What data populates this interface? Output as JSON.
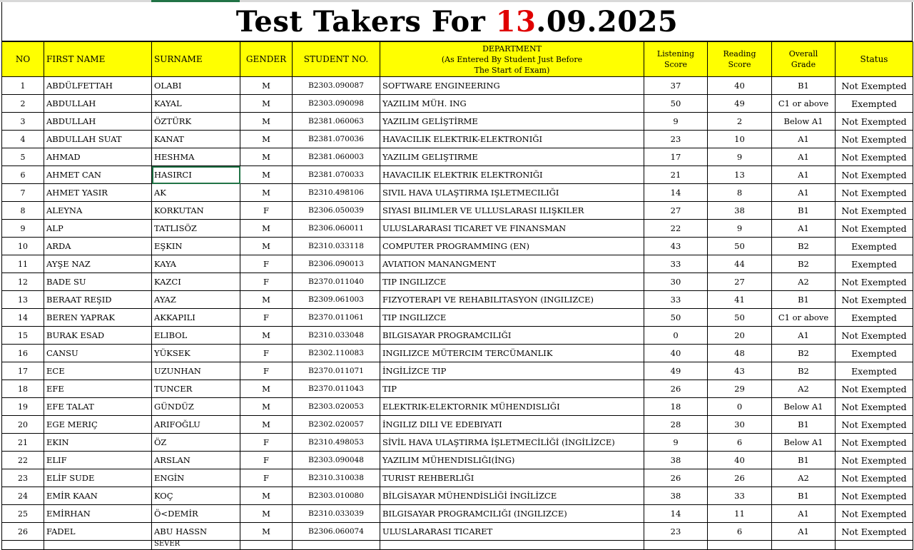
{
  "sheet": {
    "title_prefix": "Test Takers For ",
    "title_red": "13",
    "title_suffix": ".09.2025"
  },
  "header": {
    "no": "NO",
    "first_name": "FIRST NAME",
    "surname": "SURNAME",
    "gender": "GENDER",
    "student_no": "STUDENT NO.",
    "department_line1": "DEPARTMENT",
    "department_line2": "(As Entered By Student Just Before",
    "department_line3": "The Start of Exam)",
    "listening_line1": "Listening",
    "listening_line2": "Score",
    "reading_line1": "Reading",
    "reading_line2": "Score",
    "overall_line1": "Overall",
    "overall_line2": "Grade",
    "status": "Status"
  },
  "rows": [
    {
      "no": "1",
      "first": "ABDÜLFETTAH",
      "surname": "OLABI",
      "gender": "M",
      "student_no": "B2303.090087",
      "department": "SOFTWARE ENGINEERING",
      "listening": "37",
      "reading": "40",
      "grade": "B1",
      "status": "Not Exempted"
    },
    {
      "no": "2",
      "first": "ABDULLAH",
      "surname": "KAYAL",
      "gender": "M",
      "student_no": "B2303.090098",
      "department": "YAZILIM MÜH. ING",
      "listening": "50",
      "reading": "49",
      "grade": "C1 or above",
      "status": "Exempted"
    },
    {
      "no": "3",
      "first": "ABDULLAH",
      "surname": "ÖZTÜRK",
      "gender": "M",
      "student_no": "B2381.060063",
      "department": "YAZILIM GELİŞTİRME",
      "listening": "9",
      "reading": "2",
      "grade": "Below A1",
      "status": "Not Exempted"
    },
    {
      "no": "4",
      "first": "ABDULLAH SUAT",
      "surname": "KANAT",
      "gender": "M",
      "student_no": "B2381.070036",
      "department": "HAVACILIK ELEKTRIK-ELEKTRONIĞI",
      "listening": "23",
      "reading": "10",
      "grade": "A1",
      "status": "Not Exempted"
    },
    {
      "no": "5",
      "first": "AHMAD",
      "surname": "HESHMA",
      "gender": "M",
      "student_no": "B2381.060003",
      "department": "YAZILIM GELIŞTIRME",
      "listening": "17",
      "reading": "9",
      "grade": "A1",
      "status": "Not Exempted"
    },
    {
      "no": "6",
      "first": "AHMET CAN",
      "surname": "HASIRCI",
      "gender": "M",
      "student_no": "B2381.070033",
      "department": "HAVACILIK ELEKTRIK ELEKTRONIĞI",
      "listening": "21",
      "reading": "13",
      "grade": "A1",
      "status": "Not Exempted"
    },
    {
      "no": "7",
      "first": "AHMET YASIR",
      "surname": "AK",
      "gender": "M",
      "student_no": "B2310.498106",
      "department": "SIVIL HAVA ULAŞTIRMA IŞLETMECILIĞI",
      "listening": "14",
      "reading": "8",
      "grade": "A1",
      "status": "Not Exempted"
    },
    {
      "no": "8",
      "first": "ALEYNA",
      "surname": "KORKUTAN",
      "gender": "F",
      "student_no": "B2306.050039",
      "department": "SIYASI BILIMLER VE ULLUSLARASI ILIŞKILER",
      "listening": "27",
      "reading": "38",
      "grade": "B1",
      "status": "Not Exempted"
    },
    {
      "no": "9",
      "first": "ALP",
      "surname": "TATLISÖZ",
      "gender": "M",
      "student_no": "B2306.060011",
      "department": "ULUSLARARASI TICARET VE FINANSMAN",
      "listening": "22",
      "reading": "9",
      "grade": "A1",
      "status": "Not Exempted"
    },
    {
      "no": "10",
      "first": "ARDA",
      "surname": "EŞKIN",
      "gender": "M",
      "student_no": "B2310.033118",
      "department": "COMPUTER PROGRAMMING (EN)",
      "listening": "43",
      "reading": "50",
      "grade": "B2",
      "status": "Exempted"
    },
    {
      "no": "11",
      "first": "AYŞE NAZ",
      "surname": "KAYA",
      "gender": "F",
      "student_no": "B2306.090013",
      "department": "AVIATION MANANGMENT",
      "listening": "33",
      "reading": "44",
      "grade": "B2",
      "status": "Exempted"
    },
    {
      "no": "12",
      "first": "BADE SU",
      "surname": "KAZCI",
      "gender": "F",
      "student_no": "B2370.011040",
      "department": "TIP INGILIZCE",
      "listening": "30",
      "reading": "27",
      "grade": "A2",
      "status": "Not Exempted"
    },
    {
      "no": "13",
      "first": "BERAAT REŞID",
      "surname": "AYAZ",
      "gender": "M",
      "student_no": "B2309.061003",
      "department": "FIZYOTERAPI VE REHABILITASYON (INGILIZCE)",
      "listening": "33",
      "reading": "41",
      "grade": "B1",
      "status": "Not Exempted"
    },
    {
      "no": "14",
      "first": "BEREN YAPRAK",
      "surname": "AKKAPILI",
      "gender": "F",
      "student_no": "B2370.011061",
      "department": "TIP INGILIZCE",
      "listening": "50",
      "reading": "50",
      "grade": "C1 or above",
      "status": "Exempted"
    },
    {
      "no": "15",
      "first": "BURAK ESAD",
      "surname": "ELIBOL",
      "gender": "M",
      "student_no": "B2310.033048",
      "department": "BILGISAYAR PROGRAMCILIĞI",
      "listening": "0",
      "reading": "20",
      "grade": "A1",
      "status": "Not Exempted"
    },
    {
      "no": "16",
      "first": "CANSU",
      "surname": "YÜKSEK",
      "gender": "F",
      "student_no": "B2302.110083",
      "department": "INGILIZCE MÜTERCIM TERCÜMANLIK",
      "listening": "40",
      "reading": "48",
      "grade": "B2",
      "status": "Exempted"
    },
    {
      "no": "17",
      "first": "ECE",
      "surname": "UZUNHAN",
      "gender": "F",
      "student_no": "B2370.011071",
      "department": "İNGİLİZCE TIP",
      "listening": "49",
      "reading": "43",
      "grade": "B2",
      "status": "Exempted"
    },
    {
      "no": "18",
      "first": "EFE",
      "surname": "TUNCER",
      "gender": "M",
      "student_no": "B2370.011043",
      "department": "TIP",
      "listening": "26",
      "reading": "29",
      "grade": "A2",
      "status": "Not Exempted"
    },
    {
      "no": "19",
      "first": "EFE TALAT",
      "surname": "GÜNDÜZ",
      "gender": "M",
      "student_no": "B2303.020053",
      "department": "ELEKTRIK-ELEKTORNIK MÜHENDISLIĞI",
      "listening": "18",
      "reading": "0",
      "grade": "Below A1",
      "status": "Not Exempted"
    },
    {
      "no": "20",
      "first": "EGE MERIÇ",
      "surname": "ARIFOĞLU",
      "gender": "M",
      "student_no": "B2302.020057",
      "department": "İNGILIZ DILI VE EDEBIYATI",
      "listening": "28",
      "reading": "30",
      "grade": "B1",
      "status": "Not Exempted"
    },
    {
      "no": "21",
      "first": "EKIN",
      "surname": "ÖZ",
      "gender": "F",
      "student_no": "B2310.498053",
      "department": "SİVİL HAVA ULAŞTIRMA İŞLETMECİLİĞİ (İNGİLİZCE)",
      "listening": "9",
      "reading": "6",
      "grade": "Below A1",
      "status": "Not Exempted"
    },
    {
      "no": "22",
      "first": "ELIF",
      "surname": "ARSLAN",
      "gender": "F",
      "student_no": "B2303.090048",
      "department": "YAZILIM MÜHENDISLIĞI(İNG)",
      "listening": "38",
      "reading": "40",
      "grade": "B1",
      "status": "Not Exempted"
    },
    {
      "no": "23",
      "first": "ELİF SUDE",
      "surname": "ENGİN",
      "gender": "F",
      "student_no": "B2310.310038",
      "department": "TURIST REHBERLIĞI",
      "listening": "26",
      "reading": "26",
      "grade": "A2",
      "status": "Not Exempted"
    },
    {
      "no": "24",
      "first": "EMİR KAAN",
      "surname": "KOÇ",
      "gender": "M",
      "student_no": "B2303.010080",
      "department": "BİLGİSAYAR MÜHENDİSLİĞİ İNGİLİZCE",
      "listening": "38",
      "reading": "33",
      "grade": "B1",
      "status": "Not Exempted"
    },
    {
      "no": "25",
      "first": "EMİRHAN",
      "surname": "Ö<DEMİR",
      "gender": "M",
      "student_no": "B2310.033039",
      "department": "BILGISAYAR PROGRAMCILIĞI (INGILIZCE)",
      "listening": "14",
      "reading": "11",
      "grade": "A1",
      "status": "Not Exempted"
    },
    {
      "no": "26",
      "first": "FADEL",
      "surname": "ABU HASSN",
      "gender": "M",
      "student_no": "B2306.060074",
      "department": "ULUSLARARASI TICARET",
      "listening": "23",
      "reading": "6",
      "grade": "A1",
      "status": "Not Exempted"
    }
  ],
  "partial_row": {
    "surname": "SEVER"
  }
}
